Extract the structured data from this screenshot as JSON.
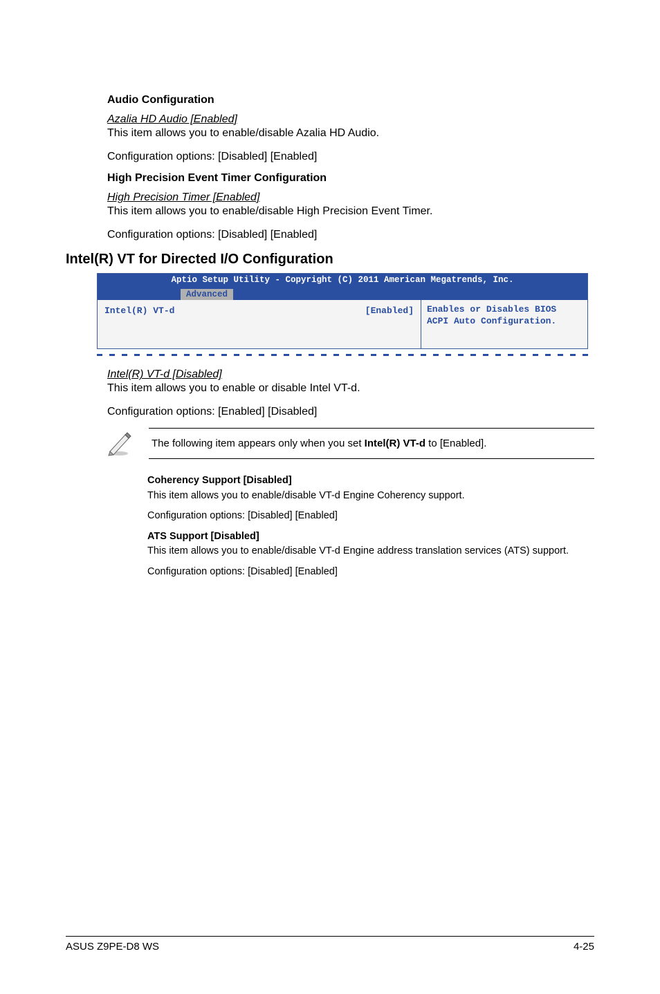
{
  "sections": {
    "audio": {
      "heading": "Audio Configuration",
      "link": "Azalia HD Audio [Enabled]",
      "desc": "This item allows you to enable/disable Azalia HD Audio.",
      "opts": "Configuration options: [Disabled] [Enabled]"
    },
    "hpet": {
      "heading": "High Precision Event Timer Configuration",
      "link": "High Precision Timer [Enabled]",
      "desc": "This item allows you to enable/disable High Precision Event Timer.",
      "opts": "Configuration options: [Disabled] [Enabled]"
    },
    "vt": {
      "heading": "Intel(R) VT for Directed I/O Configuration",
      "link": "Intel(R) VT-d [Disabled]",
      "desc": "This item allows you to enable or disable Intel VT-d.",
      "opts": "Configuration options: [Enabled] [Disabled]"
    },
    "coherency": {
      "heading": "Coherency Support [Disabled]",
      "desc": "This item allows you to enable/disable VT-d Engine Coherency support.",
      "opts": "Configuration options: [Disabled] [Enabled]"
    },
    "ats": {
      "heading": "ATS Support [Disabled]",
      "desc": "This item allows you to enable/disable VT-d Engine address translation services (ATS) support.",
      "opts": "Configuration options: [Disabled] [Enabled]"
    }
  },
  "bios": {
    "title": "Aptio Setup Utility - Copyright (C) 2011 American Megatrends, Inc.",
    "tab": "Advanced",
    "item": "Intel(R) VT-d",
    "value": "[Enabled]",
    "help": "Enables or Disables BIOS ACPI Auto Configuration."
  },
  "note": {
    "prefix": "The following item appears only when you set ",
    "bold": "Intel(R) VT-d",
    "suffix": " to [Enabled]."
  },
  "footer": {
    "left": "ASUS Z9PE-D8 WS",
    "right": "4-25"
  }
}
